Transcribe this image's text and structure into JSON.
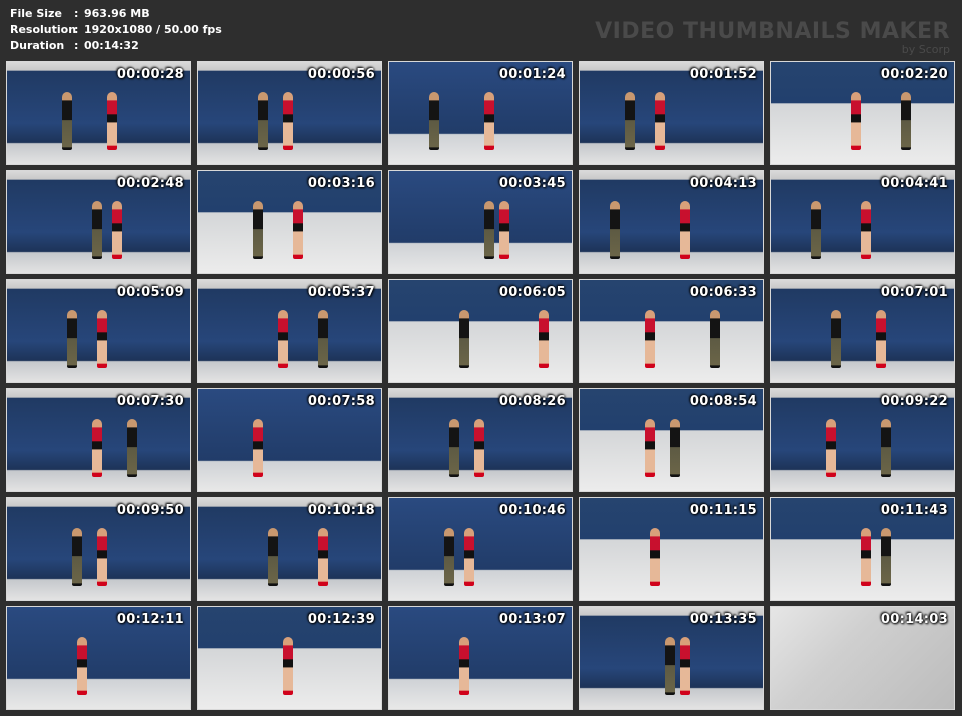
{
  "info": {
    "file_size_label": "File Size",
    "file_size_value": "963.96 MB",
    "resolution_label": "Resolution",
    "resolution_value": "1920x1080 / 50.00 fps",
    "duration_label": "Duration",
    "duration_value": "00:14:32",
    "separator": ":"
  },
  "watermark": {
    "title": "VIDEO THUMBNAILS MAKER",
    "subtitle": "by Scorp"
  },
  "thumbnails": [
    {
      "time": "00:00:28"
    },
    {
      "time": "00:00:56"
    },
    {
      "time": "00:01:24"
    },
    {
      "time": "00:01:52"
    },
    {
      "time": "00:02:20"
    },
    {
      "time": "00:02:48"
    },
    {
      "time": "00:03:16"
    },
    {
      "time": "00:03:45"
    },
    {
      "time": "00:04:13"
    },
    {
      "time": "00:04:41"
    },
    {
      "time": "00:05:09"
    },
    {
      "time": "00:05:37"
    },
    {
      "time": "00:06:05"
    },
    {
      "time": "00:06:33"
    },
    {
      "time": "00:07:01"
    },
    {
      "time": "00:07:30"
    },
    {
      "time": "00:07:58"
    },
    {
      "time": "00:08:26"
    },
    {
      "time": "00:08:54"
    },
    {
      "time": "00:09:22"
    },
    {
      "time": "00:09:50"
    },
    {
      "time": "00:10:18"
    },
    {
      "time": "00:10:46"
    },
    {
      "time": "00:11:15"
    },
    {
      "time": "00:11:43"
    },
    {
      "time": "00:12:11"
    },
    {
      "time": "00:12:39"
    },
    {
      "time": "00:13:07"
    },
    {
      "time": "00:13:35"
    },
    {
      "time": "00:14:03"
    }
  ]
}
